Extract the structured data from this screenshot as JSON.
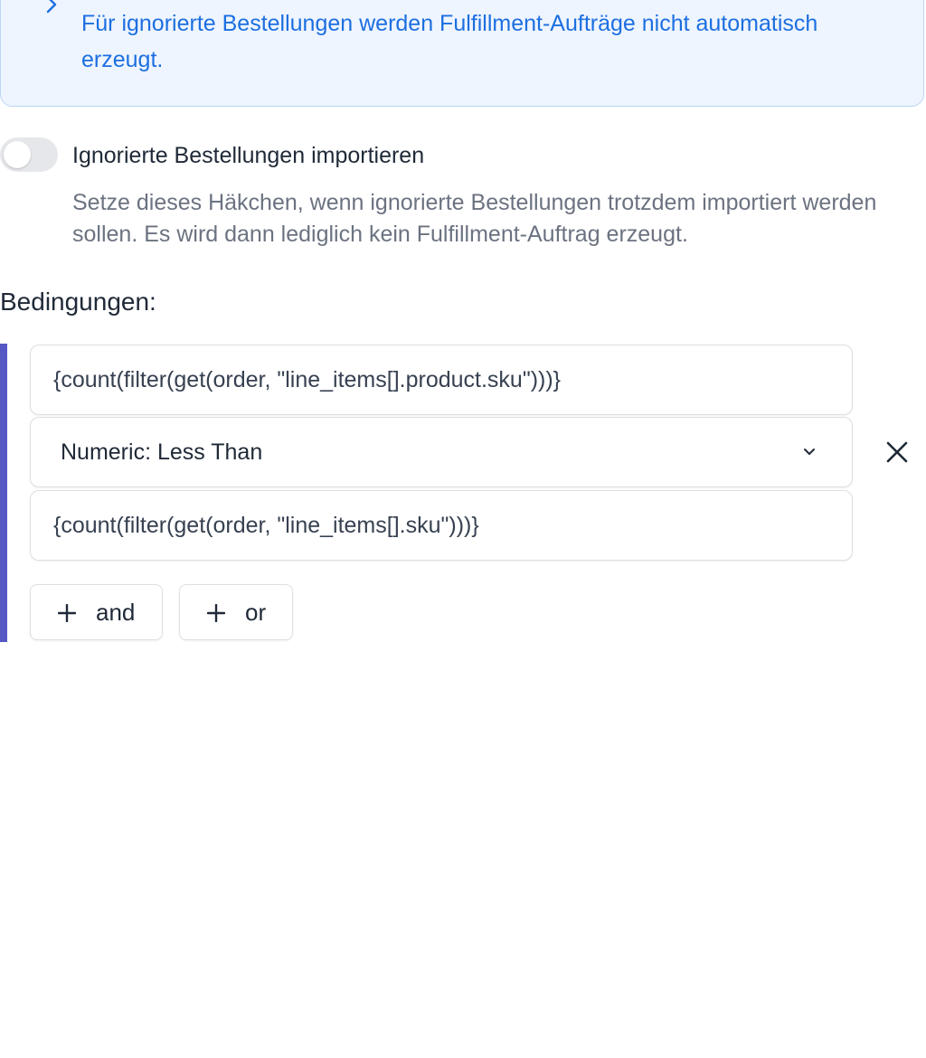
{
  "info_box": {
    "text": "Für ignorierte Bestellungen werden Fulfillment-Aufträge nicht automatisch erzeugt.",
    "accent_color": "#1d6fe0",
    "background_color": "#eef5ff",
    "icon": "chevron-right-icon"
  },
  "import_toggle": {
    "label": "Ignorierte Bestellungen importieren",
    "help": "Setze dieses Häkchen, wenn ignorierte Bestellungen trotzdem importiert werden sollen. Es wird dann lediglich kein Fulfillment-Auftrag erzeugt.",
    "checked": false
  },
  "conditions": {
    "title": "Bedingungen:",
    "group_bar_color": "#5558c4",
    "left_operand": "{count(filter(get(order, \"line_items[].product.sku\")))}",
    "operator": "Numeric: Less Than",
    "right_operand": "{count(filter(get(order, \"line_items[].sku\")))}",
    "remove_icon": "close-icon",
    "add_and_label": "and",
    "add_or_label": "or"
  }
}
